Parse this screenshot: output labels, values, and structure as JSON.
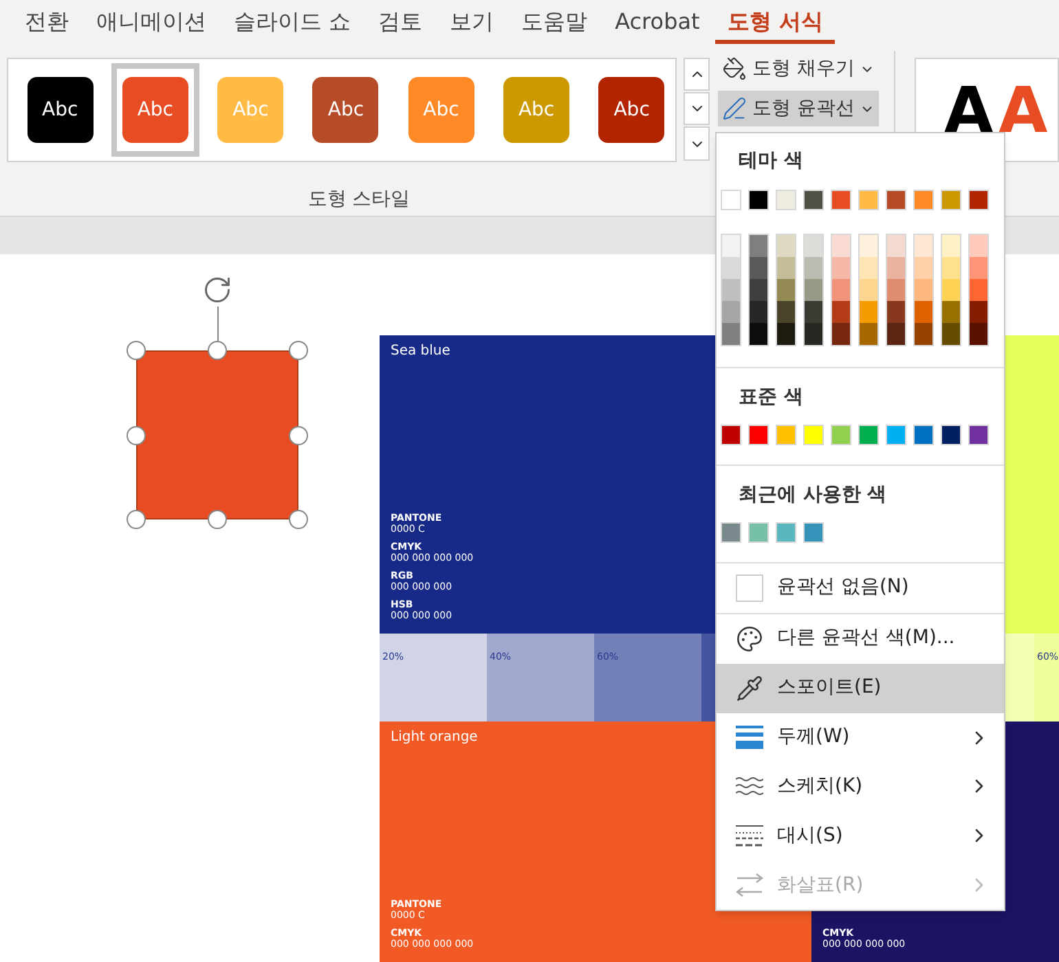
{
  "tabs": [
    {
      "label": "전환",
      "selected": false
    },
    {
      "label": "애니메이션",
      "selected": false
    },
    {
      "label": "슬라이드 쇼",
      "selected": false
    },
    {
      "label": "검토",
      "selected": false
    },
    {
      "label": "보기",
      "selected": false
    },
    {
      "label": "도움말",
      "selected": false
    },
    {
      "label": "Acrobat",
      "selected": false
    },
    {
      "label": "도형 서식",
      "selected": true
    }
  ],
  "gallery": {
    "styles": [
      {
        "label": "Abc",
        "color": "#000000",
        "selected": false
      },
      {
        "label": "Abc",
        "color": "#e84c22",
        "selected": true
      },
      {
        "label": "Abc",
        "color": "#ffbb44",
        "selected": false
      },
      {
        "label": "Abc",
        "color": "#b54b27",
        "selected": false
      },
      {
        "label": "Abc",
        "color": "#ff8827",
        "selected": false
      },
      {
        "label": "Abc",
        "color": "#cc9900",
        "selected": false
      },
      {
        "label": "Abc",
        "color": "#b32500",
        "selected": false
      }
    ],
    "group_label": "도형 스타일"
  },
  "commands": [
    {
      "kind": "fill",
      "label": "도형 채우기",
      "active": false
    },
    {
      "kind": "outline",
      "label": "도형 윤곽선",
      "active": true
    }
  ],
  "wordart": [
    {
      "label": "A",
      "color": "#000000"
    },
    {
      "label": "A",
      "color": "#e84c22"
    }
  ],
  "menu": {
    "theme_heading": "테마 색",
    "theme_colors": [
      {
        "color": "#ffffff"
      },
      {
        "color": "#000000"
      },
      {
        "color": "#eeece1"
      },
      {
        "color": "#4f5046"
      },
      {
        "color": "#e84c22"
      },
      {
        "color": "#ffbb44"
      },
      {
        "color": "#b54b27"
      },
      {
        "color": "#ff8827"
      },
      {
        "color": "#cc9900"
      },
      {
        "color": "#b32500"
      }
    ],
    "shades": [
      [
        {
          "color": "#f2f2f2"
        },
        {
          "color": "#d9d9d9"
        },
        {
          "color": "#bfbfbf"
        },
        {
          "color": "#a6a6a6"
        },
        {
          "color": "#808080"
        }
      ],
      [
        {
          "color": "#7f7f7f"
        },
        {
          "color": "#595959"
        },
        {
          "color": "#3f3f3f"
        },
        {
          "color": "#262626"
        },
        {
          "color": "#0d0d0d"
        }
      ],
      [
        {
          "color": "#ddd9c3"
        },
        {
          "color": "#c4bd97"
        },
        {
          "color": "#948a54"
        },
        {
          "color": "#4a452a"
        },
        {
          "color": "#1d1b10"
        }
      ],
      [
        {
          "color": "#dcddd8"
        },
        {
          "color": "#babbb1"
        },
        {
          "color": "#989a87"
        },
        {
          "color": "#3a3b33"
        },
        {
          "color": "#272822"
        }
      ],
      [
        {
          "color": "#fadbd3"
        },
        {
          "color": "#f5b7a6"
        },
        {
          "color": "#f0937a"
        },
        {
          "color": "#b43b17"
        },
        {
          "color": "#78270f"
        }
      ],
      [
        {
          "color": "#fff1db"
        },
        {
          "color": "#ffe4b4"
        },
        {
          "color": "#ffd68f"
        },
        {
          "color": "#f59d00"
        },
        {
          "color": "#a86800"
        }
      ],
      [
        {
          "color": "#f4d9d0"
        },
        {
          "color": "#e9b3a0"
        },
        {
          "color": "#df8d70"
        },
        {
          "color": "#87381d"
        },
        {
          "color": "#5a2513"
        }
      ],
      [
        {
          "color": "#ffe7d3"
        },
        {
          "color": "#ffcfa8"
        },
        {
          "color": "#ffb77d"
        },
        {
          "color": "#df6100"
        },
        {
          "color": "#954100"
        }
      ],
      [
        {
          "color": "#fff0c6"
        },
        {
          "color": "#ffe08d"
        },
        {
          "color": "#ffd154"
        },
        {
          "color": "#987200"
        },
        {
          "color": "#654c00"
        }
      ],
      [
        {
          "color": "#ffc9bb"
        },
        {
          "color": "#ff9477"
        },
        {
          "color": "#ff6634"
        },
        {
          "color": "#861c00"
        },
        {
          "color": "#591200"
        }
      ]
    ],
    "standard_heading": "표준 색",
    "standard_colors": [
      {
        "color": "#c00000"
      },
      {
        "color": "#ff0000"
      },
      {
        "color": "#ffc000"
      },
      {
        "color": "#ffff00"
      },
      {
        "color": "#92d050"
      },
      {
        "color": "#00b050"
      },
      {
        "color": "#00b0f0"
      },
      {
        "color": "#0070c0"
      },
      {
        "color": "#002060"
      },
      {
        "color": "#7030a0"
      }
    ],
    "recent_heading": "최근에 사용한 색",
    "recent_colors": [
      {
        "color": "#7a8a8c"
      },
      {
        "color": "#76bfa9"
      },
      {
        "color": "#5ab7bf"
      },
      {
        "color": "#3593b9"
      }
    ],
    "items": [
      {
        "kind": "none",
        "label": "윤곽선 없음(N)",
        "selected": false,
        "disabled": false,
        "submenu": false
      },
      {
        "kind": "palette",
        "label": "다른 윤곽선 색(M)...",
        "selected": false,
        "disabled": false,
        "submenu": false
      },
      {
        "kind": "eyedropper",
        "label": "스포이트(E)",
        "selected": true,
        "disabled": false,
        "submenu": false
      },
      {
        "kind": "weight",
        "label": "두께(W)",
        "selected": false,
        "disabled": false,
        "submenu": true
      },
      {
        "kind": "sketch",
        "label": "스케치(K)",
        "selected": false,
        "disabled": false,
        "submenu": true
      },
      {
        "kind": "dash",
        "label": "대시(S)",
        "selected": false,
        "disabled": false,
        "submenu": true
      },
      {
        "kind": "arrows",
        "label": "화살표(R)",
        "selected": false,
        "disabled": true,
        "submenu": true
      }
    ]
  },
  "slide": {
    "shape": {
      "color": "#e84c22"
    },
    "swatches": [
      {
        "name": "Sea blue",
        "color": "#172a87",
        "specs": [
          {
            "label": "PANTONE",
            "value": "0000 C"
          },
          {
            "label": "CMYK",
            "value": "000 000 000 000"
          },
          {
            "label": "RGB",
            "value": "000 000 000"
          },
          {
            "label": "HSB",
            "value": "000 000 000"
          }
        ],
        "tints": [
          {
            "label": "20%",
            "color": "#d1d4e7"
          },
          {
            "label": "40%",
            "color": "#a2a9cf"
          },
          {
            "label": "60%",
            "color": "#737fb7"
          },
          {
            "color": "#45549f"
          }
        ]
      },
      {
        "color": "#e5ff5a",
        "tints": [
          {
            "color": "#f3ffb5"
          },
          {
            "label": "60%",
            "color": "#efff9c"
          }
        ]
      },
      {
        "name": "Light orange",
        "color": "#f15a24",
        "specs": [
          {
            "label": "PANTONE",
            "value": "0000 C"
          },
          {
            "label": "CMYK",
            "value": "000 000 000 000"
          }
        ]
      },
      {
        "color": "#1b1464",
        "specs": [
          {
            "label": "CMYK",
            "value": "000 000 000 000"
          }
        ]
      }
    ]
  }
}
